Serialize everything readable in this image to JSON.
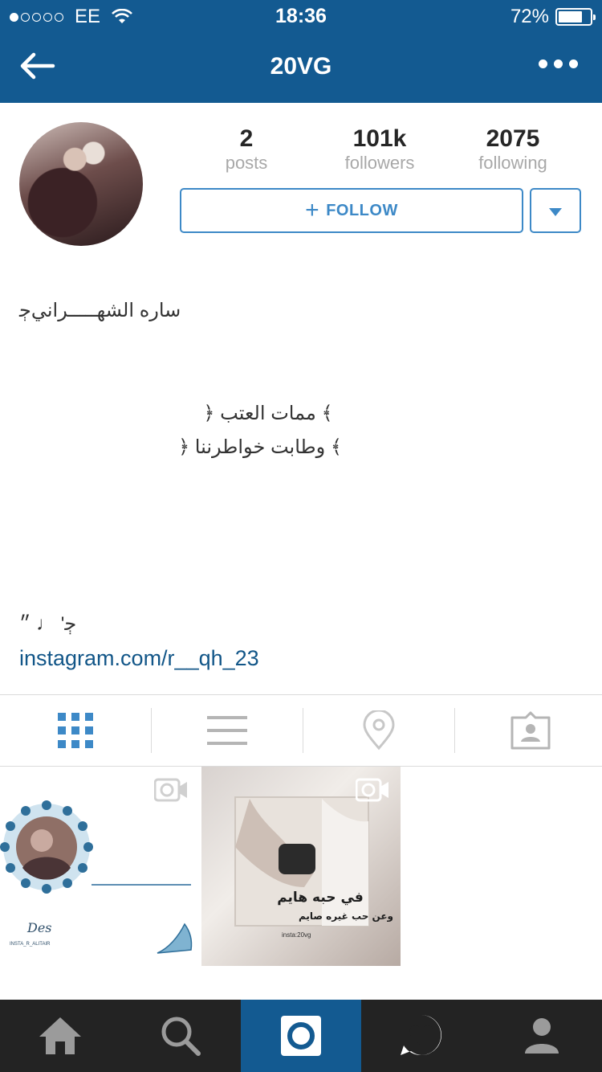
{
  "status_bar": {
    "carrier": "EE",
    "time": "18:36",
    "battery": "72%",
    "battery_level": 0.72,
    "signal_bars_filled": 1
  },
  "nav": {
    "title": "20VG",
    "back_icon": "back-arrow-icon",
    "more_icon": "more-dots-icon"
  },
  "profile": {
    "stats": [
      {
        "value": "2",
        "label": "posts"
      },
      {
        "value": "101k",
        "label": "followers"
      },
      {
        "value": "2075",
        "label": "following"
      }
    ],
    "follow_label": "FOLLOW",
    "follow_icon": "plus-icon",
    "dropdown_icon": "triangle-down-icon"
  },
  "bio": {
    "name": "ساره الشهـــــرانيﭴ",
    "line1": "﴿ ممات العتب ﴾",
    "line2": "﴿ وطابت خواطرننا ﴾",
    "notes": "ﭴ' ♩ ״",
    "link": "instagram.com/r__qh_23"
  },
  "tabs": [
    {
      "icon": "grid-icon",
      "active": true
    },
    {
      "icon": "list-icon",
      "active": false
    },
    {
      "icon": "location-pin-icon",
      "active": false
    },
    {
      "icon": "tagged-person-icon",
      "active": false
    }
  ],
  "posts": [
    {
      "type": "video",
      "icon": "video-camera-icon",
      "text": "Des",
      "sub": "INSTA_R_ALITAIR"
    },
    {
      "type": "video",
      "icon": "video-camera-icon",
      "text_line1": "في حبه هايم",
      "text_line2": "وعن حب غيره صايم",
      "tag": "insta:20vg"
    }
  ],
  "bottom_nav": [
    {
      "icon": "home-icon",
      "active": false
    },
    {
      "icon": "search-icon",
      "active": false
    },
    {
      "icon": "camera-icon",
      "active": true
    },
    {
      "icon": "activity-heart-icon",
      "active": false
    },
    {
      "icon": "profile-icon",
      "active": false
    }
  ],
  "colors": {
    "brand": "#135a91",
    "link": "#125688",
    "follow": "#3d89c7",
    "bottom_bar": "#232323"
  }
}
